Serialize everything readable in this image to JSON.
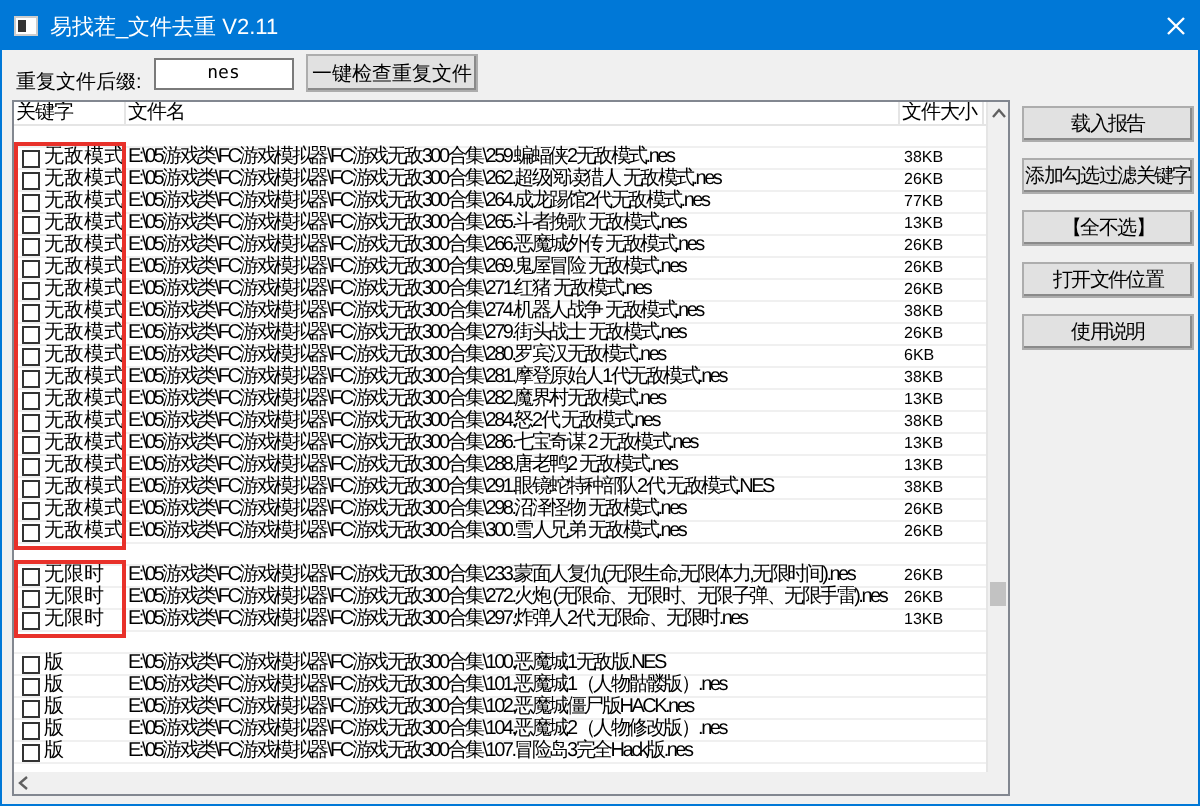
{
  "window": {
    "title": "易找茬_文件去重 V2.11"
  },
  "toolbar": {
    "suffix_label": "重复文件后缀:",
    "suffix_value": "nes",
    "check_button": "一键检查重复文件"
  },
  "table": {
    "columns": [
      "关键字",
      "文件名",
      "文件大小"
    ],
    "groups": [
      {
        "highlighted": true,
        "rows": [
          {
            "keyword": "无敌模式",
            "checked": false,
            "file": "E:\\05游戏类\\FC游戏模拟器\\FC游戏无敌300合集\\259.蝙蝠侠2无敌模式.nes",
            "size": "38KB"
          },
          {
            "keyword": "无敌模式",
            "checked": false,
            "file": "E:\\05游戏类\\FC游戏模拟器\\FC游戏无敌300合集\\262.超级阅读猎人 无敌模式.nes",
            "size": "26KB"
          },
          {
            "keyword": "无敌模式",
            "checked": false,
            "file": "E:\\05游戏类\\FC游戏模拟器\\FC游戏无敌300合集\\264.成龙踢馆2代无敌模式.nes",
            "size": "77KB"
          },
          {
            "keyword": "无敌模式",
            "checked": false,
            "file": "E:\\05游戏类\\FC游戏模拟器\\FC游戏无敌300合集\\265.斗者挽歌 无敌模式.nes",
            "size": "13KB"
          },
          {
            "keyword": "无敌模式",
            "checked": false,
            "file": "E:\\05游戏类\\FC游戏模拟器\\FC游戏无敌300合集\\266.恶魔城外传  无敌模式.nes",
            "size": "26KB"
          },
          {
            "keyword": "无敌模式",
            "checked": false,
            "file": "E:\\05游戏类\\FC游戏模拟器\\FC游戏无敌300合集\\269.鬼屋冒险 无敌模式.nes",
            "size": "26KB"
          },
          {
            "keyword": "无敌模式",
            "checked": false,
            "file": "E:\\05游戏类\\FC游戏模拟器\\FC游戏无敌300合集\\271.红猪 无敌模式.nes",
            "size": "26KB"
          },
          {
            "keyword": "无敌模式",
            "checked": false,
            "file": "E:\\05游戏类\\FC游戏模拟器\\FC游戏无敌300合集\\274.机器人战争  无敌模式.nes",
            "size": "38KB"
          },
          {
            "keyword": "无敌模式",
            "checked": false,
            "file": "E:\\05游戏类\\FC游戏模拟器\\FC游戏无敌300合集\\279.街头战士 无敌模式.nes",
            "size": "26KB"
          },
          {
            "keyword": "无敌模式",
            "checked": false,
            "file": "E:\\05游戏类\\FC游戏模拟器\\FC游戏无敌300合集\\280.罗宾汉无敌模式.nes",
            "size": "6KB"
          },
          {
            "keyword": "无敌模式",
            "checked": false,
            "file": "E:\\05游戏类\\FC游戏模拟器\\FC游戏无敌300合集\\281.摩登原始人1代无敌模式.nes",
            "size": "38KB"
          },
          {
            "keyword": "无敌模式",
            "checked": false,
            "file": "E:\\05游戏类\\FC游戏模拟器\\FC游戏无敌300合集\\282.魔界村无敌模式.nes",
            "size": "13KB"
          },
          {
            "keyword": "无敌模式",
            "checked": false,
            "file": "E:\\05游戏类\\FC游戏模拟器\\FC游戏无敌300合集\\284.怒2代 无敌模式.nes",
            "size": "38KB"
          },
          {
            "keyword": "无敌模式",
            "checked": false,
            "file": "E:\\05游戏类\\FC游戏模拟器\\FC游戏无敌300合集\\286.七宝奇谋 2 无敌模式.nes",
            "size": "13KB"
          },
          {
            "keyword": "无敌模式",
            "checked": false,
            "file": "E:\\05游戏类\\FC游戏模拟器\\FC游戏无敌300合集\\288.唐老鸭2 无敌模式.nes",
            "size": "13KB"
          },
          {
            "keyword": "无敌模式",
            "checked": false,
            "file": "E:\\05游戏类\\FC游戏模拟器\\FC游戏无敌300合集\\291.眼镜蛇特种部队2代 无敌模式.NES",
            "size": "38KB"
          },
          {
            "keyword": "无敌模式",
            "checked": false,
            "file": "E:\\05游戏类\\FC游戏模拟器\\FC游戏无敌300合集\\298.沼泽怪物 无敌模式.nes",
            "size": "26KB"
          },
          {
            "keyword": "无敌模式",
            "checked": false,
            "file": "E:\\05游戏类\\FC游戏模拟器\\FC游戏无敌300合集\\300.雪人兄弟 无敌模式.nes",
            "size": "26KB"
          }
        ]
      },
      {
        "highlighted": true,
        "rows": [
          {
            "keyword": "无限时",
            "checked": false,
            "file": "E:\\05游戏类\\FC游戏模拟器\\FC游戏无敌300合集\\233.蒙面人复仇(无限生命,无限体力,无限时间).nes",
            "size": "26KB"
          },
          {
            "keyword": "无限时",
            "checked": false,
            "file": "E:\\05游戏类\\FC游戏模拟器\\FC游戏无敌300合集\\272.火炮 (无限命、无限时、无限子弹、无限手雷).nes",
            "size": "26KB"
          },
          {
            "keyword": "无限时",
            "checked": false,
            "file": "E:\\05游戏类\\FC游戏模拟器\\FC游戏无敌300合集\\297.炸弹人2代 无限命、无限时.nes",
            "size": "13KB"
          }
        ]
      },
      {
        "highlighted": false,
        "rows": [
          {
            "keyword": "版",
            "checked": false,
            "file": "E:\\05游戏类\\FC游戏模拟器\\FC游戏无敌300合集\\100.恶魔城1无敌版.NES"
          },
          {
            "keyword": "版",
            "checked": false,
            "file": "E:\\05游戏类\\FC游戏模拟器\\FC游戏无敌300合集\\101.恶魔城1（人物骷髅版）.nes"
          },
          {
            "keyword": "版",
            "checked": false,
            "file": "E:\\05游戏类\\FC游戏模拟器\\FC游戏无敌300合集\\102.恶魔城僵尸版HACK.nes"
          },
          {
            "keyword": "版",
            "checked": false,
            "file": "E:\\05游戏类\\FC游戏模拟器\\FC游戏无敌300合集\\104.恶魔城2（人物修改版）.nes"
          },
          {
            "keyword": "版",
            "checked": false,
            "file": "E:\\05游戏类\\FC游戏模拟器\\FC游戏无敌300合集\\107.冒险岛3完全Hack版.nes"
          }
        ]
      }
    ]
  },
  "buttons": [
    "载入报告",
    "添加勾选过滤关键字",
    "【全不选】",
    "打开文件位置",
    "使用说明"
  ]
}
